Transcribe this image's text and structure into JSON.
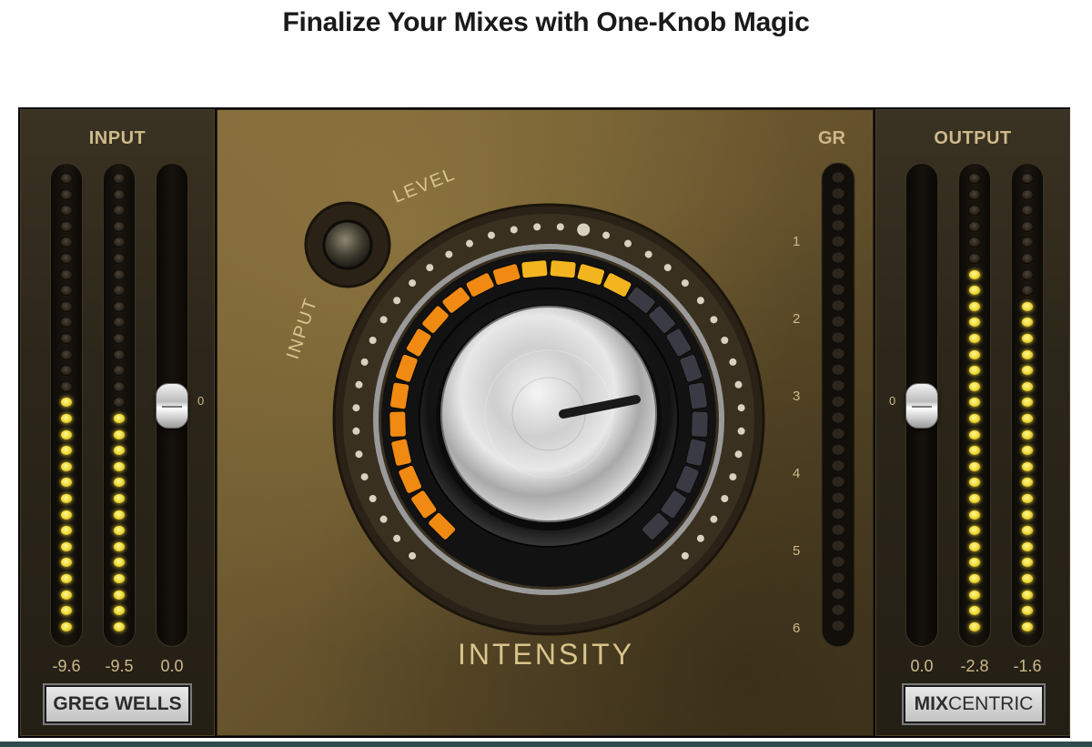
{
  "page": {
    "title": "Finalize Your Mixes with One-Knob Magic"
  },
  "plugin": {
    "input_panel": {
      "label": "INPUT",
      "fader_zero_label": "0",
      "fader_level": 0.5,
      "meter_left_lit": 15,
      "meter_right_lit": 14,
      "readouts": [
        "-9.6",
        "-9.5",
        "0.0"
      ],
      "brand": "GREG WELLS"
    },
    "center": {
      "level_label": "LEVEL",
      "input_label": "INPUT",
      "intensity_label": "INTENSITY",
      "gr_label": "GR",
      "gr_scale": [
        "1",
        "2",
        "3",
        "4",
        "5",
        "6"
      ],
      "gr_meter_lit": 0,
      "intensity_fraction": 0.62,
      "colors": {
        "led_orange": "#f08a12",
        "led_gold": "#f2b520",
        "led_off": "#3a3a44",
        "gold_text": "#cdb98a"
      }
    },
    "output_panel": {
      "label": "OUTPUT",
      "fader_zero_label": "0",
      "fader_level": 0.5,
      "meter_left_lit": 23,
      "meter_right_lit": 21,
      "readouts": [
        "0.0",
        "-2.8",
        "-1.6"
      ],
      "brand_bold": "MIX",
      "brand_thin": "CENTRIC"
    }
  }
}
